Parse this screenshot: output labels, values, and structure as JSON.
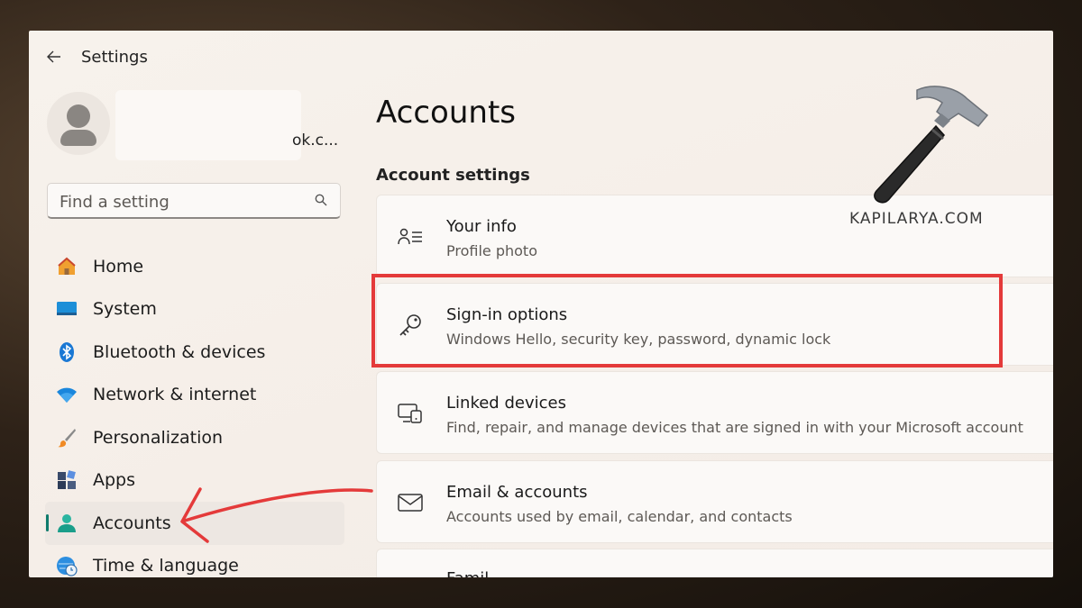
{
  "window": {
    "title": "Settings"
  },
  "profile": {
    "email_fragment": "ok.c..."
  },
  "search": {
    "placeholder": "Find a setting"
  },
  "nav": {
    "items": [
      {
        "label": "Home",
        "icon": "home-icon"
      },
      {
        "label": "System",
        "icon": "monitor-icon"
      },
      {
        "label": "Bluetooth & devices",
        "icon": "bluetooth-icon"
      },
      {
        "label": "Network & internet",
        "icon": "wifi-icon"
      },
      {
        "label": "Personalization",
        "icon": "brush-icon"
      },
      {
        "label": "Apps",
        "icon": "apps-icon"
      },
      {
        "label": "Accounts",
        "icon": "person-icon",
        "active": true
      },
      {
        "label": "Time & language",
        "icon": "globe-clock-icon"
      }
    ]
  },
  "main": {
    "page_title": "Accounts",
    "section_title": "Account settings",
    "cards": [
      {
        "title": "Your info",
        "subtitle": "Profile photo",
        "icon": "person-list-icon"
      },
      {
        "title": "Sign-in options",
        "subtitle": "Windows Hello, security key, password, dynamic lock",
        "icon": "key-icon"
      },
      {
        "title": "Linked devices",
        "subtitle": "Find, repair, and manage devices that are signed in with your Microsoft account",
        "icon": "linked-devices-icon"
      },
      {
        "title": "Email & accounts",
        "subtitle": "Accounts used by email, calendar, and contacts",
        "icon": "mail-icon"
      },
      {
        "title": "Famil",
        "subtitle": "",
        "icon": ""
      }
    ]
  },
  "watermark": {
    "text": "KAPILARYA.COM"
  },
  "colors": {
    "accent": "#0f7b6c",
    "highlight": "#e43a3a",
    "window_bg": "#f6f0ea"
  }
}
